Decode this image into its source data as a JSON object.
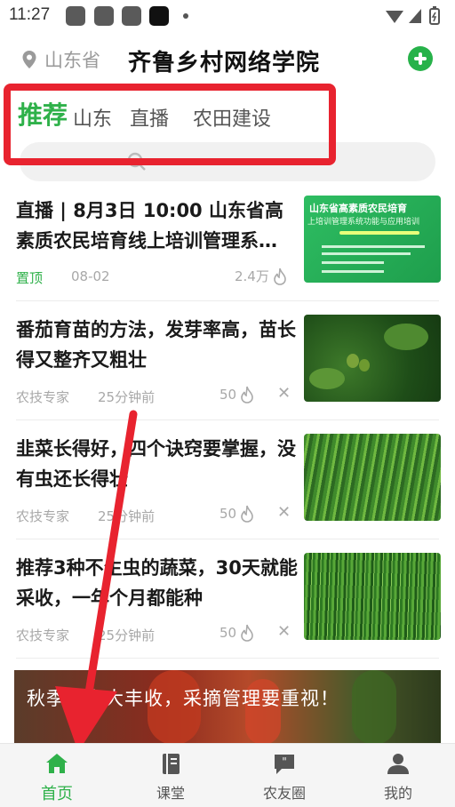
{
  "status_bar": {
    "time": "11:27"
  },
  "header": {
    "location": "山东省",
    "title": "齐鲁乡村网络学院"
  },
  "tabs": [
    {
      "label": "推荐",
      "active": true
    },
    {
      "label": "山东",
      "active": false
    },
    {
      "label": "直播",
      "active": false
    },
    {
      "label": "农田建设",
      "active": false
    }
  ],
  "articles": [
    {
      "title": "直播 | 8月3日 10:00 山东省高素质农民培育线上培训管理系…",
      "tag": "置顶",
      "time": "08-02",
      "hot": "2.4万",
      "thumbnail": {
        "line1": "山东省高素质农民培育",
        "line2": "上培训管理系统功能与应用培训"
      }
    },
    {
      "title": "番茄育苗的方法，发芽率高，苗长得又整齐又粗壮",
      "source": "农技专家",
      "time": "25分钟前",
      "hot": "50"
    },
    {
      "title": "韭菜长得好，四个诀窍要掌握，没有虫还长得壮",
      "source": "农技专家",
      "time": "25分钟前",
      "hot": "50"
    },
    {
      "title": "推荐3种不生虫的蔬菜，30天就能采收，一年个月都能种",
      "source": "农技专家",
      "time": "25分钟前",
      "hot": "50"
    }
  ],
  "banner": {
    "text": "秋季辣椒大丰收，采摘管理要重视！"
  },
  "bottom_nav": [
    {
      "label": "首页",
      "icon": "home-icon",
      "active": true
    },
    {
      "label": "课堂",
      "icon": "book-icon",
      "active": false
    },
    {
      "label": "农友圈",
      "icon": "chat-bubble-icon",
      "active": false
    },
    {
      "label": "我的",
      "icon": "user-icon",
      "active": false
    }
  ],
  "colors": {
    "accent": "#2fb14a",
    "annotation_red": "#e8232f"
  }
}
